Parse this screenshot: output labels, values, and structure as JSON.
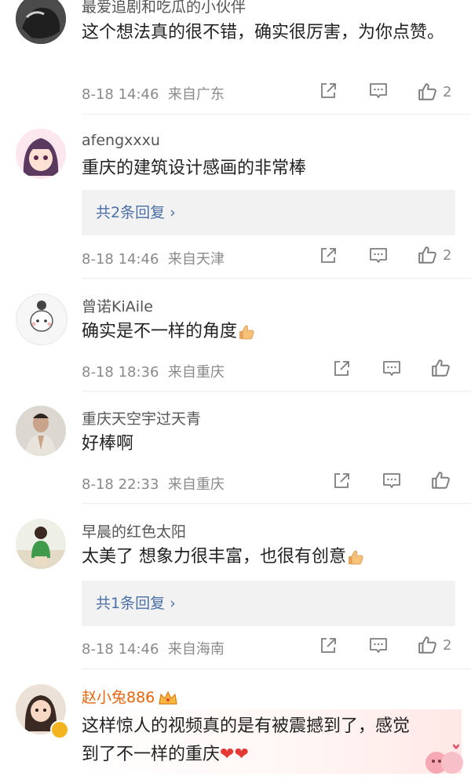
{
  "comments": [
    {
      "name": "最爱追剧和吃瓜的小伙伴",
      "text": "这个想法真的很不错，确实很厉害，为你点赞。",
      "time": "8-18 14:46",
      "location": "来自广东",
      "likes": "2"
    },
    {
      "name": "afengxxxu",
      "text": "重庆的建筑设计感画的非常棒",
      "replies": "共2条回复 ›",
      "time": "8-18 14:46",
      "location": "来自天津",
      "likes": "2"
    },
    {
      "name": "曾诺KiAile",
      "text": "确实是不一样的角度",
      "time": "8-18 18:36",
      "location": "来自重庆",
      "likes": ""
    },
    {
      "name": "重庆天空宇过天青",
      "text": "好棒啊",
      "time": "8-18 22:33",
      "location": "来自重庆",
      "likes": ""
    },
    {
      "name": "早晨的红色太阳",
      "text": "太美了 想象力很丰富，也很有创意",
      "replies": "共1条回复 ›",
      "time": "8-18 14:46",
      "location": "来自海南",
      "likes": "2"
    },
    {
      "name": "赵小兔886",
      "text": "这样惊人的视频真的是有被震撼到了，感觉到了不一样的重庆",
      "emoji": "❤❤"
    }
  ],
  "icons": {
    "share": "share-icon",
    "comment": "comment-icon",
    "like": "thumbs-up-icon",
    "crown": "crown-icon",
    "thumbs_emoji": "thumbs-up-emoji"
  },
  "colors": {
    "reply_link": "#4a6fa5",
    "vip_name": "#e8640c",
    "heart": "#e53935"
  }
}
